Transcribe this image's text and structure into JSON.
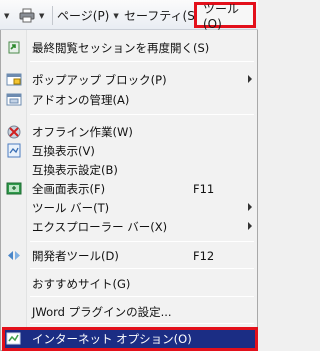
{
  "toolbar": {
    "page_label": "ページ(P)",
    "safety_label": "セーフティ(S)",
    "tools_label": "ツール(O)"
  },
  "menu": {
    "items": [
      {
        "label": "最終閲覧セッションを再度開く(S)",
        "icon": "reopen-session-icon"
      },
      {
        "label": "ポップアップ ブロック(P)",
        "icon": "popup-blocker-icon",
        "submenu": true
      },
      {
        "label": "アドオンの管理(A)",
        "icon": "addons-icon"
      },
      {
        "label": "オフライン作業(W)",
        "icon": "offline-icon"
      },
      {
        "label": "互換表示(V)",
        "icon": "compat-view-icon"
      },
      {
        "label": "互換表示設定(B)"
      },
      {
        "label": "全画面表示(F)",
        "icon": "fullscreen-icon",
        "shortcut": "F11"
      },
      {
        "label": "ツール バー(T)",
        "submenu": true
      },
      {
        "label": "エクスプローラー バー(X)",
        "submenu": true
      },
      {
        "label": "開発者ツール(D)",
        "icon": "developer-tools-icon",
        "shortcut": "F12"
      },
      {
        "label": "おすすめサイト(G)"
      },
      {
        "label": "JWord プラグインの設定..."
      },
      {
        "label": "インターネット オプション(O)",
        "icon": "internet-options-icon",
        "highlighted": true
      }
    ]
  },
  "colors": {
    "highlight_bg": "#1b2d84",
    "highlight_border": "#e3101b"
  }
}
